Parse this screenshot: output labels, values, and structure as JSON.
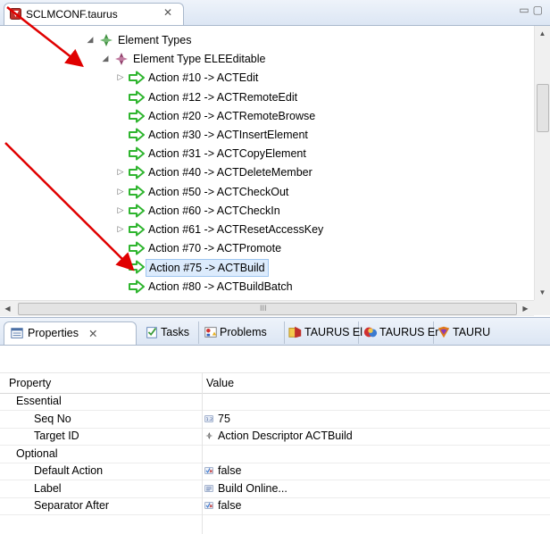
{
  "editor": {
    "tab_title": "SCLMCONF.taurus",
    "close_glyph": "✕"
  },
  "tree": {
    "rows": [
      {
        "label": "Element Types",
        "indent": 0,
        "toggle": "◢",
        "icon": "element-types-icon",
        "selected": false
      },
      {
        "label": "Element Type ELEEditable",
        "indent": 1,
        "toggle": "◢",
        "icon": "element-type-icon",
        "selected": false
      },
      {
        "label": "Action #10  -> ACTEdit",
        "indent": 2,
        "toggle": "▷",
        "icon": "action-arrow-icon",
        "selected": false
      },
      {
        "label": "Action #12  -> ACTRemoteEdit",
        "indent": 2,
        "toggle": "",
        "icon": "action-arrow-icon",
        "selected": false
      },
      {
        "label": "Action #20  -> ACTRemoteBrowse",
        "indent": 2,
        "toggle": "",
        "icon": "action-arrow-icon",
        "selected": false
      },
      {
        "label": "Action #30  -> ACTInsertElement",
        "indent": 2,
        "toggle": "",
        "icon": "action-arrow-icon",
        "selected": false
      },
      {
        "label": "Action #31  -> ACTCopyElement",
        "indent": 2,
        "toggle": "",
        "icon": "action-arrow-icon",
        "selected": false
      },
      {
        "label": "Action #40  -> ACTDeleteMember",
        "indent": 2,
        "toggle": "▷",
        "icon": "action-arrow-icon",
        "selected": false
      },
      {
        "label": "Action #50  -> ACTCheckOut",
        "indent": 2,
        "toggle": "▷",
        "icon": "action-arrow-icon",
        "selected": false
      },
      {
        "label": "Action #60  -> ACTCheckIn",
        "indent": 2,
        "toggle": "▷",
        "icon": "action-arrow-icon",
        "selected": false
      },
      {
        "label": "Action #61  -> ACTResetAccessKey",
        "indent": 2,
        "toggle": "▷",
        "icon": "action-arrow-icon",
        "selected": false
      },
      {
        "label": "Action #70  -> ACTPromote",
        "indent": 2,
        "toggle": "",
        "icon": "action-arrow-icon",
        "selected": false
      },
      {
        "label": "Action #75  -> ACTBuild",
        "indent": 2,
        "toggle": "",
        "icon": "action-arrow-icon",
        "selected": true
      },
      {
        "label": "Action #80  -> ACTBuildBatch",
        "indent": 2,
        "toggle": "",
        "icon": "action-arrow-icon",
        "selected": false
      }
    ]
  },
  "scrollbar": {
    "grip": "III"
  },
  "props_tabs": [
    {
      "label": "Properties",
      "icon": "properties-icon",
      "active": true,
      "close": "✕"
    },
    {
      "label": "Tasks",
      "icon": "tasks-icon",
      "active": false
    },
    {
      "label": "Problems",
      "icon": "problems-icon",
      "active": false
    },
    {
      "label": "TAURUS El",
      "icon": "taurus-element-icon",
      "active": false
    },
    {
      "label": "TAURUS Er",
      "icon": "taurus-error-icon",
      "active": false
    },
    {
      "label": "TAURU",
      "icon": "taurus-icon",
      "active": false
    }
  ],
  "props_table": {
    "headers": {
      "property": "Property",
      "value": "Value"
    },
    "rows": [
      {
        "key": "Essential",
        "level": 0,
        "value": "",
        "icon": ""
      },
      {
        "key": "Seq No",
        "level": 1,
        "value": "75",
        "icon": "number-icon"
      },
      {
        "key": "Target ID",
        "level": 1,
        "value": "Action Descriptor ACTBuild",
        "icon": "descriptor-icon"
      },
      {
        "key": "Optional",
        "level": 0,
        "value": "",
        "icon": ""
      },
      {
        "key": "Default Action",
        "level": 1,
        "value": "false",
        "icon": "boolean-icon"
      },
      {
        "key": "Label",
        "level": 1,
        "value": "Build Online...",
        "icon": "text-icon"
      },
      {
        "key": "Separator After",
        "level": 1,
        "value": "false",
        "icon": "boolean-icon"
      }
    ]
  },
  "colors": {
    "annotation_red": "#e00000",
    "action_green": "#2fb52f",
    "selection_bg": "#dcebfc"
  }
}
